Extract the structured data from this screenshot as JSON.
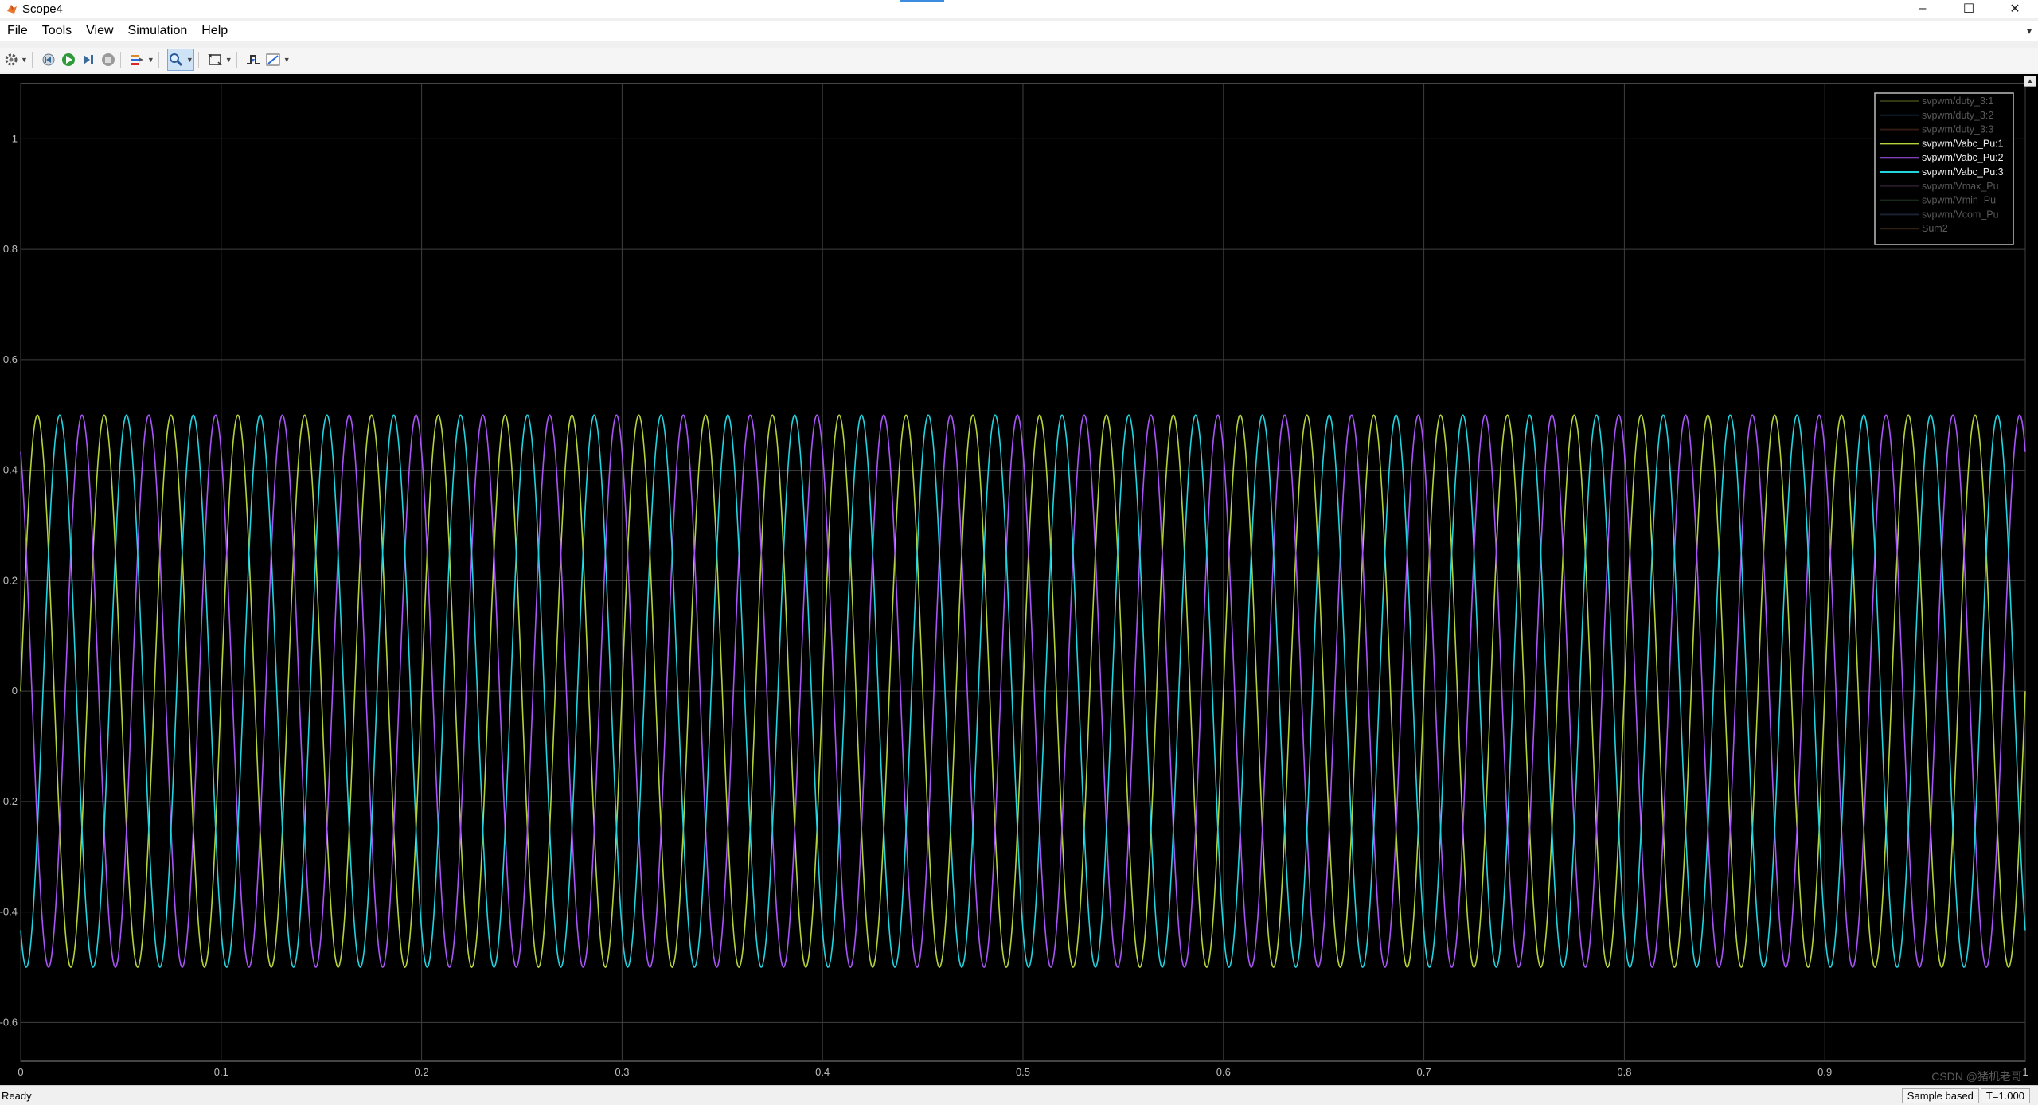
{
  "window": {
    "title": "Scope4",
    "minimize_label": "–",
    "maximize_label": "☐",
    "close_label": "✕"
  },
  "menu": {
    "items": [
      "File",
      "Tools",
      "View",
      "Simulation",
      "Help"
    ],
    "dock_label": "▾"
  },
  "toolbar": {
    "buttons": [
      {
        "name": "settings-gear",
        "icon": "gear-icon",
        "has_dropdown": true
      },
      {
        "name": "step-back",
        "icon": "step-back-icon",
        "has_dropdown": false
      },
      {
        "name": "run",
        "icon": "play-icon",
        "has_dropdown": false
      },
      {
        "name": "step-forward",
        "icon": "step-forward-icon",
        "has_dropdown": false
      },
      {
        "name": "stop",
        "icon": "stop-icon",
        "has_dropdown": false
      },
      {
        "name": "highlight",
        "icon": "highlight-icon",
        "has_dropdown": true
      },
      {
        "name": "zoom",
        "icon": "zoom-icon",
        "has_dropdown": true,
        "active": true
      },
      {
        "name": "autoscale",
        "icon": "autoscale-icon",
        "has_dropdown": true
      },
      {
        "name": "triggers",
        "icon": "trigger-icon",
        "has_dropdown": false
      },
      {
        "name": "measurements",
        "icon": "measure-icon",
        "has_dropdown": true
      }
    ]
  },
  "chart_data": {
    "type": "line",
    "title": "",
    "xlabel": "",
    "ylabel": "",
    "xlim": [
      0,
      1
    ],
    "ylim": [
      -0.67,
      1.1
    ],
    "x_ticks": [
      "0",
      "0.1",
      "0.2",
      "0.3",
      "0.4",
      "0.5",
      "0.6",
      "0.7",
      "0.8",
      "0.9",
      "1"
    ],
    "y_ticks": [
      "1",
      "0.8",
      "0.6",
      "0.4",
      "0.2",
      "0",
      "-0.2",
      "-0.4",
      "-0.6"
    ],
    "x_tick_values": [
      0,
      0.1,
      0.2,
      0.3,
      0.4,
      0.5,
      0.6,
      0.7,
      0.8,
      0.9,
      1.0
    ],
    "y_tick_values": [
      1,
      0.8,
      0.6,
      0.4,
      0.2,
      0,
      -0.2,
      -0.4,
      -0.6
    ],
    "grid": true,
    "legend_position": "top-right",
    "legend": [
      {
        "name": "svpwm/duty_3:1",
        "color": "#6b7f28",
        "visible": false
      },
      {
        "name": "svpwm/duty_3:2",
        "color": "#2a4a6a",
        "visible": false
      },
      {
        "name": "svpwm/duty_3:3",
        "color": "#6a3a2a",
        "visible": false
      },
      {
        "name": "svpwm/Vabc_Pu:1",
        "color": "#b4d33a",
        "visible": true
      },
      {
        "name": "svpwm/Vabc_Pu:2",
        "color": "#a855f7",
        "visible": true
      },
      {
        "name": "svpwm/Vabc_Pu:3",
        "color": "#22d3e0",
        "visible": true
      },
      {
        "name": "svpwm/Vmax_Pu",
        "color": "#5a3a5a",
        "visible": false
      },
      {
        "name": "svpwm/Vmin_Pu",
        "color": "#3a5a3a",
        "visible": false
      },
      {
        "name": "svpwm/Vcom_Pu",
        "color": "#3a4a6a",
        "visible": false
      },
      {
        "name": "Sum2",
        "color": "#6a4a2a",
        "visible": false
      }
    ],
    "series": [
      {
        "name": "svpwm/Vabc_Pu:1",
        "amplitude": 0.5,
        "frequency_hz": 30,
        "phase_deg": 0,
        "color": "#b4d33a"
      },
      {
        "name": "svpwm/Vabc_Pu:2",
        "amplitude": 0.5,
        "frequency_hz": 30,
        "phase_deg": 120,
        "color": "#a855f7"
      },
      {
        "name": "svpwm/Vabc_Pu:3",
        "amplitude": 0.5,
        "frequency_hz": 30,
        "phase_deg": -120,
        "color": "#22d3e0"
      }
    ]
  },
  "status": {
    "left": "Ready",
    "sample_mode": "Sample based",
    "time": "T=1.000",
    "watermark": "CSDN @猪机老哥"
  }
}
